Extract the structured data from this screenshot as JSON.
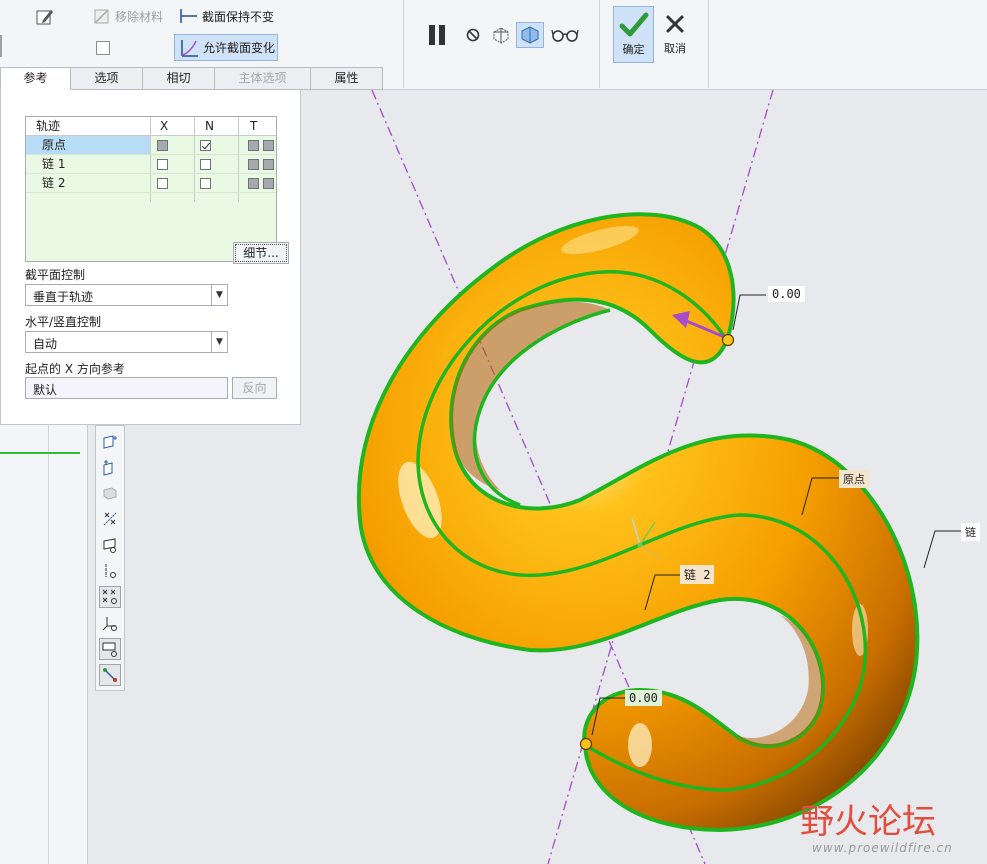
{
  "ribbon": {
    "remove_material": "移除材料",
    "section_keep_constant": "截面保持不变",
    "allow_section_change": "允许截面变化",
    "ok_label": "确定",
    "cancel_label": "取消"
  },
  "tabs": [
    {
      "label": "参考",
      "state": "active"
    },
    {
      "label": "选项",
      "state": "normal"
    },
    {
      "label": "相切",
      "state": "normal"
    },
    {
      "label": "主体选项",
      "state": "disabled"
    },
    {
      "label": "属性",
      "state": "normal"
    }
  ],
  "panel": {
    "table": {
      "headers": [
        "轨迹",
        "X",
        "N",
        "T"
      ],
      "rows": [
        {
          "name": "原点",
          "x": "filled",
          "n": "checked",
          "selected": true
        },
        {
          "name": "链 1",
          "x": "empty",
          "n": "empty",
          "selected": false
        },
        {
          "name": "链 2",
          "x": "empty",
          "n": "empty",
          "selected": false
        }
      ]
    },
    "details_button": "细节...",
    "section_plane_control_label": "截平面控制",
    "section_plane_control_value": "垂直于轨迹",
    "hv_control_label": "水平/竖直控制",
    "hv_control_value": "自动",
    "x_ref_label": "起点的 X 方向参考",
    "x_ref_value": "默认",
    "flip_button": "反向"
  },
  "viewport": {
    "callouts": {
      "top_value": "0.00",
      "bottom_value": "0.00",
      "origin": "原点",
      "chain2": "链 2",
      "chain_right": "链"
    },
    "colors": {
      "body": "#f5a300",
      "edge": "#1fb51f",
      "axis": "#a64ccc",
      "background": "#e8e9ec"
    }
  },
  "watermark": {
    "text_cn": "野火论坛",
    "url": "www.proewildfire.cn"
  }
}
